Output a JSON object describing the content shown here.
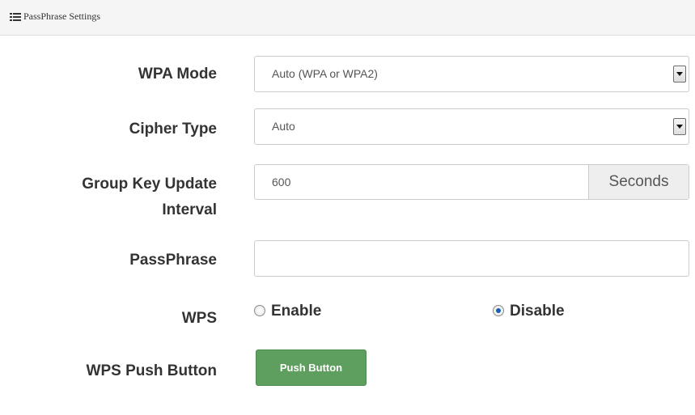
{
  "panel": {
    "title": "PassPhrase Settings",
    "icon": "list-icon"
  },
  "wpa_mode": {
    "label": "WPA Mode",
    "value": "Auto (WPA or WPA2)"
  },
  "cipher_type": {
    "label": "Cipher Type",
    "value": "Auto"
  },
  "group_key": {
    "label_line1": "Group Key Update",
    "label_line2": "Interval",
    "value": "600",
    "unit": "Seconds"
  },
  "passphrase": {
    "label": "PassPhrase",
    "value": ""
  },
  "wps": {
    "label": "WPS",
    "options": [
      {
        "label": "Enable",
        "checked": false
      },
      {
        "label": "Disable",
        "checked": true
      }
    ]
  },
  "wps_push": {
    "label": "WPS Push Button",
    "button": "Push Button"
  },
  "colors": {
    "button": "#5e9f5f",
    "header_bg": "#f5f5f5",
    "radio_checked": "#1a5fb4"
  }
}
